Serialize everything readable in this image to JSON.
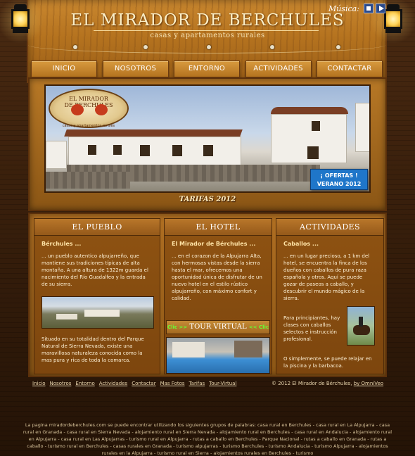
{
  "header": {
    "title": "EL MIRADOR DE BERCHULES",
    "subtitle": "casas y apartamentos rurales",
    "music_label": "Música:"
  },
  "nav": {
    "items": [
      "INICIO",
      "NOSOTROS",
      "ENTORNO",
      "ACTIVIDADES",
      "CONTACTAR"
    ]
  },
  "hero": {
    "logo_text_1": "EL MIRADOR",
    "logo_text_2": "DE BERCHULES",
    "logo_subtitle": "casas y apartamentos rurales",
    "ofertas_1": "¡ OFERTAS !",
    "ofertas_2": "VERANO 2012",
    "tarifas": "TARIFAS 2012"
  },
  "columns": {
    "pueblo": {
      "heading": "EL PUEBLO",
      "subheading": "Bérchules ...",
      "text1": "... un pueblo autentico alpujarreño, que mantiene sus tradiciones típicas de alta montaña. A una altura de 1322m guarda el nacimiento del Río Guadalfeo y la entrada de su sierra.",
      "text2": "Situado en su totalidad dentro del Parque Natural de Sierra Nevada, existe una maravillosa naturaleza conocida como la mas pura y rica de toda la comarca."
    },
    "hotel": {
      "heading": "EL HOTEL",
      "subheading": "El Mirador de Bérchules ...",
      "text1": "... en el corazon de la Alpujarra Alta, con hermosas vistas desde la sierra hasta el mar, ofrecemos una oportunidad única de disfrutar de un nuevo hotel en el estilo rústico alpujarreño, con máximo confort y calidad.",
      "tour_left": "Clic >>",
      "tour_label": "TOUR VIRTUAL",
      "tour_right": "<< Clic"
    },
    "actividades": {
      "heading": "ACTIVIDADES",
      "subheading": "Caballos ...",
      "text1": "... en un lugar precioso, a 1 km del hotel, se encuentra la finca de los dueños con caballos de pura raza española y otros. Aquí se puede gozar de paseos a caballo, y descubrir el mundo mágico de la sierra.",
      "text2": "Para principiantes, hay clases con caballos selectos e instrucción profesional.",
      "text3": "O simplemente, se puede relajar en la piscina y la barbacoa."
    }
  },
  "footer": {
    "links": [
      "Inicio",
      "Nosotros",
      "Entorno",
      "Actividades",
      "Contactar",
      "Mas Fotos",
      "Tarifas",
      "Tour-Virtual"
    ],
    "copyright": "© 2012 El Mirador de Bérchules,",
    "credit": "by OmniVeo",
    "seo": "La pagina miradordeberchules.com se puede encontrar utilizando los siguientes grupos de palabras: casa rural en Berchules - casa rural en La Alpujarra - casa rural en Granada - casa rural en Sierra Nevada - alojamiento rural en Sierra Nevada - alojamiento rural en Berchules - casa rural en Andalucia - alojamiento rural en Alpujarra - casa rural en Las Alpujarras - turismo rural en Alpujarra - rutas a caballo en Berchules - Parque Nacional - rutas a caballo en Granada - rutas a caballo - turismo rural en Berchules - casas rurales en Granada - turismo alpujarras - turismo Berchules - turismo Andalucia - turismo Alpujarra - alojamientos rurales en la Alpujarra - turismo rural en Sierra - alojamientos rurales en Berchules - turismo"
  },
  "colors": {
    "wood_dark": "#2a1608",
    "wood_light": "#c9872f",
    "accent_text": "#ffe3a6",
    "offer_blue": "#1f76c9",
    "tour_green": "#66ff33"
  },
  "icons": [
    "lantern-left-icon",
    "lantern-right-icon",
    "music-stop-icon",
    "music-play-icon"
  ]
}
